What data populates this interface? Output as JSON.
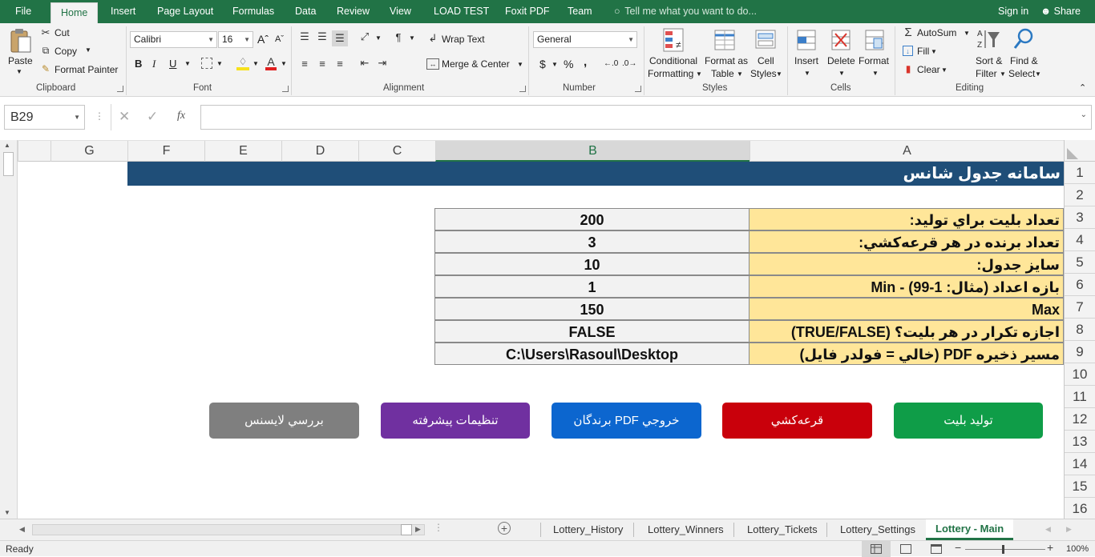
{
  "menu": {
    "file": "File",
    "tabs": [
      "Home",
      "Insert",
      "Page Layout",
      "Formulas",
      "Data",
      "Review",
      "View",
      "LOAD TEST",
      "Foxit PDF",
      "Team"
    ],
    "tell_me": "Tell me what you want to do...",
    "sign_in": "Sign in",
    "share": "Share"
  },
  "ribbon": {
    "clipboard": {
      "paste": "Paste",
      "cut": "Cut",
      "copy": "Copy",
      "format_painter": "Format Painter",
      "label": "Clipboard"
    },
    "font": {
      "name": "Calibri",
      "size": "16",
      "bold": "B",
      "italic": "I",
      "underline": "U",
      "label": "Font"
    },
    "alignment": {
      "wrap_text": "Wrap Text",
      "merge_center": "Merge & Center",
      "label": "Alignment"
    },
    "number": {
      "format": "General",
      "currency": "$",
      "percent": "%",
      "comma": ",",
      "label": "Number"
    },
    "styles": {
      "conditional": "Conditional",
      "conditional2": "Formatting",
      "format_table": "Format as",
      "format_table2": "Table",
      "cell_styles": "Cell",
      "cell_styles2": "Styles",
      "label": "Styles"
    },
    "cells": {
      "insert": "Insert",
      "delete": "Delete",
      "format": "Format",
      "label": "Cells"
    },
    "editing": {
      "autosum": "AutoSum",
      "fill": "Fill",
      "clear": "Clear",
      "sort": "Sort &",
      "sort2": "Filter",
      "find": "Find &",
      "find2": "Select",
      "label": "Editing"
    }
  },
  "formula_bar": {
    "name_box": "B29",
    "formula": "",
    "fx": "fx"
  },
  "columns": [
    "G",
    "F",
    "E",
    "D",
    "C",
    "B",
    "A"
  ],
  "rows": [
    "1",
    "2",
    "3",
    "4",
    "5",
    "6",
    "7",
    "8",
    "9",
    "10",
    "11",
    "12",
    "13",
    "14",
    "15",
    "16"
  ],
  "sheet": {
    "title": "سامانه جدول شانس",
    "params": [
      {
        "label": "تعداد بليت براي توليد:",
        "value": "200"
      },
      {
        "label": "تعداد برنده در هر قرعه‌كشي:",
        "value": "3"
      },
      {
        "label": "سايز جدول:",
        "value": "10"
      },
      {
        "label": "بازه اعداد (مثال: 1-99) - Min",
        "value": "1"
      },
      {
        "label": "Max",
        "value": "150"
      },
      {
        "label": "اجازه تكرار در هر بليت؟ (TRUE/FALSE)",
        "value": "FALSE"
      },
      {
        "label": "مسير ذخيره PDF (خالي = فولدر فايل)",
        "value": "C:\\Users\\Rasoul\\Desktop"
      }
    ],
    "buttons": {
      "generate": "توليد بليت",
      "draw": "قرعه‌كشي",
      "export": "خروجي PDF برندگان",
      "settings": "تنظيمات پيشرفته",
      "license": "بررسي لايسنس"
    }
  },
  "sheet_tabs": [
    "Lottery_History",
    "Lottery_Winners",
    "Lottery_Tickets",
    "Lottery_Settings",
    "Lottery - Main"
  ],
  "status": {
    "ready": "Ready",
    "zoom": "100%"
  },
  "colors": {
    "excel_green": "#217346",
    "title_fill": "#1f4e78",
    "label_fill": "#ffe699"
  }
}
